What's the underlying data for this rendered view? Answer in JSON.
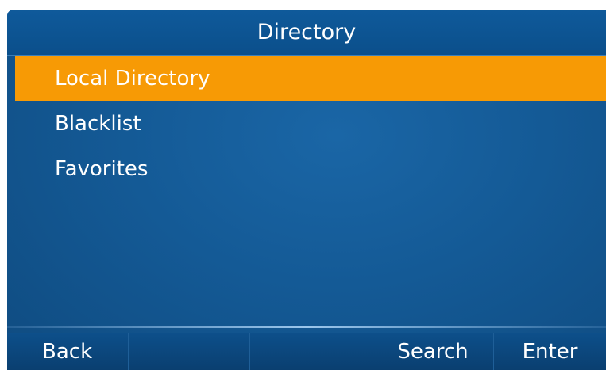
{
  "header": {
    "title": "Directory"
  },
  "menu": {
    "items": [
      {
        "label": "Local Directory",
        "selected": true
      },
      {
        "label": "Blacklist",
        "selected": false
      },
      {
        "label": "Favorites",
        "selected": false
      }
    ]
  },
  "softkeys": {
    "key1": "Back",
    "key2": "",
    "key3": "",
    "key4": "Search",
    "key5": "Enter"
  },
  "colors": {
    "selection": "#f79a05",
    "background": "#145a96"
  }
}
